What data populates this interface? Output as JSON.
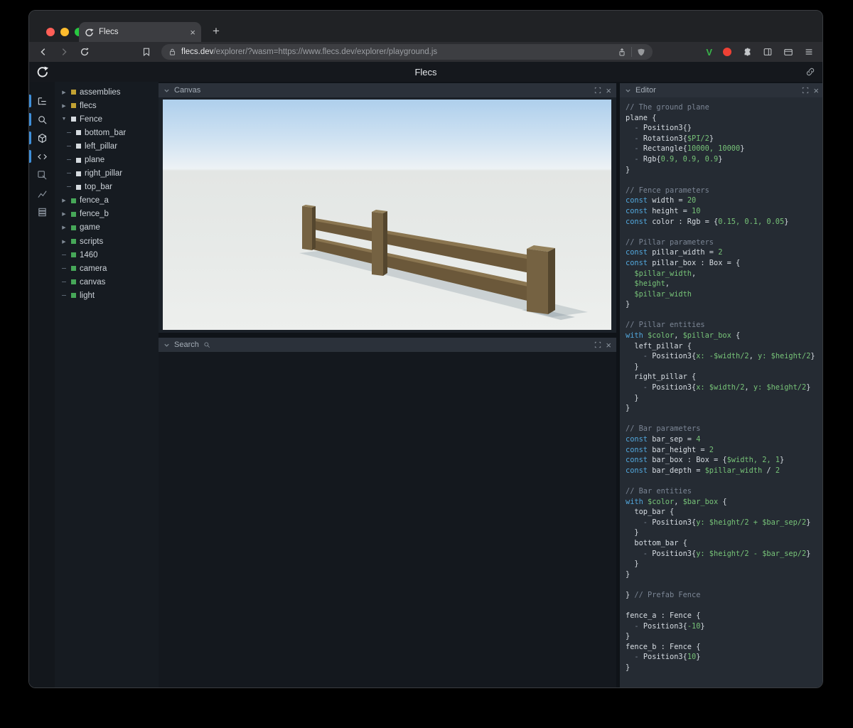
{
  "colors": {
    "accent_blue": "#3f8fd9",
    "entity_yellow": "#c2a233",
    "entity_white": "#d6dbe0",
    "entity_green": "#46a758",
    "code_keyword": "#52a7dc",
    "code_value": "#77c378",
    "code_comment": "#7b8594",
    "traffic_red": "#ff5f57",
    "traffic_yellow": "#febc2e",
    "traffic_green": "#28c840",
    "fence_wood": "#756242"
  },
  "browser": {
    "tab_title": "Flecs",
    "close_tab": "×",
    "new_tab": "+",
    "url_host": "flecs.dev",
    "url_path": "/explorer/?wasm=https://www.flecs.dev/explorer/playground.js",
    "v_badge": "V"
  },
  "app": {
    "title": "Flecs"
  },
  "panels": {
    "canvas": {
      "title": "Canvas",
      "close": "×"
    },
    "search": {
      "title": "Search",
      "close": "×"
    },
    "editor": {
      "title": "Editor",
      "close": "×"
    }
  },
  "icon_sidebar": {
    "items": [
      {
        "name": "tree-icon",
        "active": true
      },
      {
        "name": "search-icon",
        "active": true
      },
      {
        "name": "scene-icon",
        "active": true
      },
      {
        "name": "code-icon",
        "active": true
      },
      {
        "name": "inspect-icon",
        "active": false
      },
      {
        "name": "stats-icon",
        "active": false
      },
      {
        "name": "memory-icon",
        "active": false
      }
    ]
  },
  "tree": {
    "items": [
      {
        "label": "assemblies",
        "arrow": "right",
        "color": "#c2a233",
        "depth": 0
      },
      {
        "label": "flecs",
        "arrow": "right",
        "color": "#c2a233",
        "depth": 0
      },
      {
        "label": "Fence",
        "arrow": "down",
        "color": "#d6dbe0",
        "depth": 0
      },
      {
        "label": "bottom_bar",
        "arrow": "leaf",
        "color": "#d6dbe0",
        "depth": 1
      },
      {
        "label": "left_pillar",
        "arrow": "leaf",
        "color": "#d6dbe0",
        "depth": 1
      },
      {
        "label": "plane",
        "arrow": "leaf",
        "color": "#d6dbe0",
        "depth": 1
      },
      {
        "label": "right_pillar",
        "arrow": "leaf",
        "color": "#d6dbe0",
        "depth": 1
      },
      {
        "label": "top_bar",
        "arrow": "leaf",
        "color": "#d6dbe0",
        "depth": 1
      },
      {
        "label": "fence_a",
        "arrow": "right",
        "color": "#46a758",
        "depth": 0
      },
      {
        "label": "fence_b",
        "arrow": "right",
        "color": "#46a758",
        "depth": 0
      },
      {
        "label": "game",
        "arrow": "right",
        "color": "#46a758",
        "depth": 0
      },
      {
        "label": "scripts",
        "arrow": "right",
        "color": "#46a758",
        "depth": 0
      },
      {
        "label": "1460",
        "arrow": "leaf",
        "color": "#46a758",
        "depth": 0
      },
      {
        "label": "camera",
        "arrow": "leaf",
        "color": "#46a758",
        "depth": 0
      },
      {
        "label": "canvas",
        "arrow": "leaf",
        "color": "#46a758",
        "depth": 0
      },
      {
        "label": "light",
        "arrow": "leaf",
        "color": "#46a758",
        "depth": 0
      }
    ]
  },
  "editor": {
    "code": [
      [
        [
          "c",
          "// The ground plane"
        ]
      ],
      [
        [
          "p",
          "plane {"
        ]
      ],
      [
        [
          "d",
          "  - "
        ],
        [
          "p",
          "Position3{}"
        ]
      ],
      [
        [
          "d",
          "  - "
        ],
        [
          "p",
          "Rotation3{"
        ],
        [
          "g",
          "$PI/2"
        ],
        [
          "p",
          "}"
        ]
      ],
      [
        [
          "d",
          "  - "
        ],
        [
          "p",
          "Rectangle{"
        ],
        [
          "g",
          "10000, 10000"
        ],
        [
          "p",
          "}"
        ]
      ],
      [
        [
          "d",
          "  - "
        ],
        [
          "p",
          "Rgb{"
        ],
        [
          "g",
          "0.9, 0.9, 0.9"
        ],
        [
          "p",
          "}"
        ]
      ],
      [
        [
          "p",
          "}"
        ]
      ],
      [],
      [
        [
          "c",
          "// Fence parameters"
        ]
      ],
      [
        [
          "k",
          "const "
        ],
        [
          "p",
          "width = "
        ],
        [
          "g",
          "20"
        ]
      ],
      [
        [
          "k",
          "const "
        ],
        [
          "p",
          "height = "
        ],
        [
          "g",
          "10"
        ]
      ],
      [
        [
          "k",
          "const "
        ],
        [
          "p",
          "color : Rgb = {"
        ],
        [
          "g",
          "0.15, 0.1, 0.05"
        ],
        [
          "p",
          "}"
        ]
      ],
      [],
      [
        [
          "c",
          "// Pillar parameters"
        ]
      ],
      [
        [
          "k",
          "const "
        ],
        [
          "p",
          "pillar_width = "
        ],
        [
          "g",
          "2"
        ]
      ],
      [
        [
          "k",
          "const "
        ],
        [
          "p",
          "pillar_box : Box = {"
        ]
      ],
      [
        [
          "g",
          "  $pillar_width"
        ],
        [
          "p",
          ","
        ]
      ],
      [
        [
          "g",
          "  $height"
        ],
        [
          "p",
          ","
        ]
      ],
      [
        [
          "g",
          "  $pillar_width"
        ]
      ],
      [
        [
          "p",
          "}"
        ]
      ],
      [],
      [
        [
          "c",
          "// Pillar entities"
        ]
      ],
      [
        [
          "k",
          "with "
        ],
        [
          "g",
          "$color"
        ],
        [
          "p",
          ", "
        ],
        [
          "g",
          "$pillar_box"
        ],
        [
          "p",
          " {"
        ]
      ],
      [
        [
          "p",
          "  left_pillar {"
        ]
      ],
      [
        [
          "d",
          "    - "
        ],
        [
          "p",
          "Position3{"
        ],
        [
          "g",
          "x: -$width/2"
        ],
        [
          "p",
          ", "
        ],
        [
          "g",
          "y: $height/2"
        ],
        [
          "p",
          "}"
        ]
      ],
      [
        [
          "p",
          "  }"
        ]
      ],
      [
        [
          "p",
          "  right_pillar {"
        ]
      ],
      [
        [
          "d",
          "    - "
        ],
        [
          "p",
          "Position3{"
        ],
        [
          "g",
          "x: $width/2"
        ],
        [
          "p",
          ", "
        ],
        [
          "g",
          "y: $height/2"
        ],
        [
          "p",
          "}"
        ]
      ],
      [
        [
          "p",
          "  }"
        ]
      ],
      [
        [
          "p",
          "}"
        ]
      ],
      [],
      [
        [
          "c",
          "// Bar parameters"
        ]
      ],
      [
        [
          "k",
          "const "
        ],
        [
          "p",
          "bar_sep = "
        ],
        [
          "g",
          "4"
        ]
      ],
      [
        [
          "k",
          "const "
        ],
        [
          "p",
          "bar_height = "
        ],
        [
          "g",
          "2"
        ]
      ],
      [
        [
          "k",
          "const "
        ],
        [
          "p",
          "bar_box : Box = {"
        ],
        [
          "g",
          "$width, 2, 1"
        ],
        [
          "p",
          "}"
        ]
      ],
      [
        [
          "k",
          "const "
        ],
        [
          "p",
          "bar_depth = "
        ],
        [
          "g",
          "$pillar_width"
        ],
        [
          "p",
          " / "
        ],
        [
          "g",
          "2"
        ]
      ],
      [],
      [
        [
          "c",
          "// Bar entities"
        ]
      ],
      [
        [
          "k",
          "with "
        ],
        [
          "g",
          "$color"
        ],
        [
          "p",
          ", "
        ],
        [
          "g",
          "$bar_box"
        ],
        [
          "p",
          " {"
        ]
      ],
      [
        [
          "p",
          "  top_bar {"
        ]
      ],
      [
        [
          "d",
          "    - "
        ],
        [
          "p",
          "Position3{"
        ],
        [
          "g",
          "y: $height/2 + $bar_sep/2"
        ],
        [
          "p",
          "}"
        ]
      ],
      [
        [
          "p",
          "  }"
        ]
      ],
      [
        [
          "p",
          "  bottom_bar {"
        ]
      ],
      [
        [
          "d",
          "    - "
        ],
        [
          "p",
          "Position3{"
        ],
        [
          "g",
          "y: $height/2 - $bar_sep/2"
        ],
        [
          "p",
          "}"
        ]
      ],
      [
        [
          "p",
          "  }"
        ]
      ],
      [
        [
          "p",
          "}"
        ]
      ],
      [],
      [
        [
          "p",
          "} "
        ],
        [
          "c",
          "// Prefab Fence"
        ]
      ],
      [],
      [
        [
          "p",
          "fence_a : Fence {"
        ]
      ],
      [
        [
          "d",
          "  - "
        ],
        [
          "p",
          "Position3{"
        ],
        [
          "g",
          "-10"
        ],
        [
          "p",
          "}"
        ]
      ],
      [
        [
          "p",
          "}"
        ]
      ],
      [
        [
          "p",
          "fence_b : Fence {"
        ]
      ],
      [
        [
          "d",
          "  - "
        ],
        [
          "p",
          "Position3{"
        ],
        [
          "g",
          "10"
        ],
        [
          "p",
          "}"
        ]
      ],
      [
        [
          "p",
          "}"
        ]
      ]
    ]
  }
}
